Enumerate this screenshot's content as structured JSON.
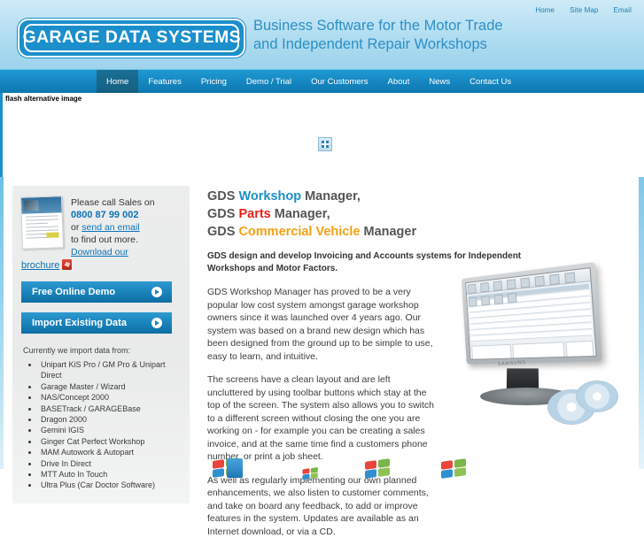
{
  "header": {
    "logo_text": "GARAGE DATA SYSTEMS",
    "tagline_line1": "Business Software for the Motor Trade",
    "tagline_line2": "and Independent Repair Workshops",
    "utility_nav": [
      {
        "label": "Home"
      },
      {
        "label": "Site Map"
      },
      {
        "label": "Email"
      }
    ]
  },
  "mainnav": {
    "items": [
      {
        "label": "Home",
        "active": true
      },
      {
        "label": "Features",
        "active": false
      },
      {
        "label": "Pricing",
        "active": false
      },
      {
        "label": "Demo / Trial",
        "active": false
      },
      {
        "label": "Our Customers",
        "active": false
      },
      {
        "label": "About",
        "active": false
      },
      {
        "label": "News",
        "active": false
      },
      {
        "label": "Contact Us",
        "active": false
      }
    ]
  },
  "flash_area": {
    "alt_text": "flash alternative image",
    "broken_image_icon": "broken-image-icon"
  },
  "sidebar": {
    "brochure_thumbnail": "brochure-thumbnail",
    "contact_lead": "Please call Sales on",
    "phone": "0800 87 99 002",
    "or_text": "or ",
    "email_link": "send an email",
    "find_out_more": "to find out more.",
    "download_link": "Download our",
    "brochure_link": "brochure",
    "pdf_icon": "pdf-icon",
    "buttons": [
      {
        "label": "Free Online Demo"
      },
      {
        "label": "Import Existing Data"
      }
    ],
    "import_title": "Currently we import data from:",
    "import_list": [
      "Unipart KiS Pro / GM Pro & Unipart Direct",
      "Garage Master / Wizard",
      "NAS/Concept 2000",
      "BASETrack / GARAGEBase",
      "Dragon 2000",
      "Gemini IGIS",
      "Ginger Cat Perfect Workshop",
      "MAM Autowork & Autopart",
      "Drive In Direct",
      "MTT Auto In Touch",
      "Ultra Plus (Car Doctor Software)"
    ]
  },
  "main": {
    "heading_lines": [
      {
        "prefix": "GDS ",
        "keyword": "Workshop",
        "suffix": " Manager,",
        "keyword_color": "#1b8fcc"
      },
      {
        "prefix": "GDS ",
        "keyword": "Parts",
        "suffix": " Manager,",
        "keyword_color": "#e8201a"
      },
      {
        "prefix": "GDS ",
        "keyword": "Commercial Vehicle",
        "suffix": " Manager",
        "keyword_color": "#f5a013"
      }
    ],
    "lead": "GDS design and develop Invoicing and Accounts systems for Independent Workshops and Motor Factors.",
    "paragraphs": [
      "GDS Workshop Manager has proved to be a very popular low cost system amongst garage workshop owners since it was launched over 4 years ago. Our system was based on a brand new design which has been designed from the ground up to be simple to use, easy to learn, and intuitive.",
      "The screens have a clean layout and are left uncluttered by using toolbar buttons which stay at the top of the screen. The system also allows you to switch to a different screen without closing the one you are working on - for example you can be creating a sales invoice, and at the same time find a customers phone number, or print a job sheet.",
      "As well as regularly implementing our own planned enhancements, we also listen to customer comments, and take on board any feedback, to add or improve features in the system. Updates are available as an Internet download, or via a CD."
    ],
    "monitor_image": "monitor-screenshot-image",
    "monitor_brand": "SAMSUNG"
  },
  "badges": {
    "items": [
      {
        "name": "windows-software-box-badge"
      },
      {
        "name": "windows-logo-badge-small"
      },
      {
        "name": "windows-logo-badge-medium"
      },
      {
        "name": "windows-logo-badge-large"
      }
    ]
  },
  "colors": {
    "brand_blue": "#1b8fcc",
    "nav_blue": "#1687c1",
    "link_blue": "#0c73b8",
    "red": "#e8201a",
    "orange": "#f5a013"
  }
}
